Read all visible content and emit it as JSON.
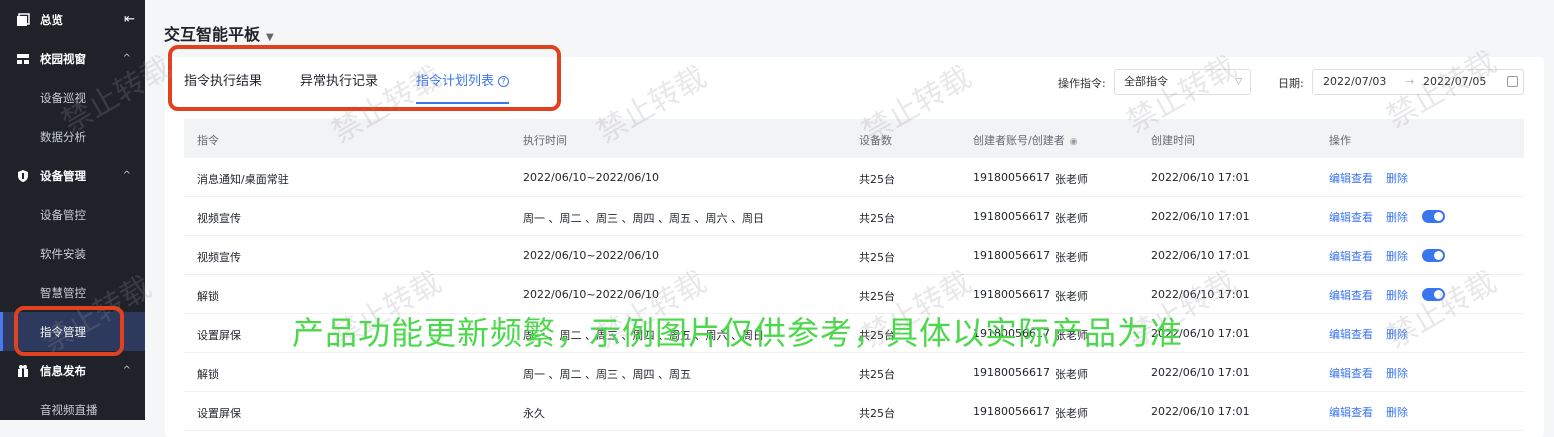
{
  "sidebar": {
    "overview": "总览",
    "groups": {
      "campus": "校园视窗",
      "device": "设备管理",
      "info": "信息发布"
    },
    "items": {
      "patrol": "设备巡视",
      "analysis": "数据分析",
      "device_control": "设备管控",
      "software": "软件安装",
      "smart": "智慧管控",
      "command": "指令管理",
      "live": "音视频直播"
    }
  },
  "header": {
    "title": "交互智能平板"
  },
  "tabs": [
    {
      "label": "指令执行结果"
    },
    {
      "label": "异常执行记录"
    },
    {
      "label": "指令计划列表"
    }
  ],
  "filters": {
    "op_label": "操作指令:",
    "op_value": "全部指令",
    "date_label": "日期:",
    "date_start": "2022/07/03",
    "date_end": "2022/07/05"
  },
  "table": {
    "headers": [
      "指令",
      "执行时间",
      "设备数",
      "创建者账号/创建者",
      "创建时间",
      "操作"
    ],
    "edit_label": "编辑查看",
    "delete_label": "删除",
    "rows": [
      {
        "cmd": "消息通知/桌面常驻",
        "time": "2022/06/10~2022/06/10",
        "count": "共25台",
        "account": "19180056617",
        "creator": "张老师",
        "created": "2022/06/10 17:01",
        "toggle": false
      },
      {
        "cmd": "视频宣传",
        "time": "周一 、周二 、周三 、周四 、周五 、周六 、周日",
        "count": "共25台",
        "account": "19180056617",
        "creator": "张老师",
        "created": "2022/06/10 17:01",
        "toggle": true
      },
      {
        "cmd": "视频宣传",
        "time": "2022/06/10~2022/06/10",
        "count": "共25台",
        "account": "19180056617",
        "creator": "张老师",
        "created": "2022/06/10 17:01",
        "toggle": true
      },
      {
        "cmd": "解锁",
        "time": "2022/06/10~2022/06/10",
        "count": "共25台",
        "account": "19180056617",
        "creator": "张老师",
        "created": "2022/06/10 17:01",
        "toggle": true
      },
      {
        "cmd": "设置屏保",
        "time": "周一 、周二 、周三 、周四 、周五 、周六 、周日",
        "count": "共25台",
        "account": "19180056617",
        "creator": "张老师",
        "created": "2022/06/10 17:01",
        "toggle": false
      },
      {
        "cmd": "解锁",
        "time": "周一 、周二 、周三 、周四 、周五",
        "count": "共25台",
        "account": "19180056617",
        "creator": "张老师",
        "created": "2022/06/10 17:01",
        "toggle": false
      },
      {
        "cmd": "设置屏保",
        "time": "永久",
        "count": "共25台",
        "account": "19180056617",
        "creator": "张老师",
        "created": "2022/06/10 17:01",
        "toggle": false
      }
    ]
  },
  "overlay_text": "产品功能更新频繁，示例图片仅供参考，具体以实际产品为准",
  "watermark": "禁止转载",
  "colors": {
    "accent": "#3a75f0",
    "sidebar_bg": "#1f2329",
    "highlight": "#e0411f",
    "overlay": "#4cd84c"
  }
}
